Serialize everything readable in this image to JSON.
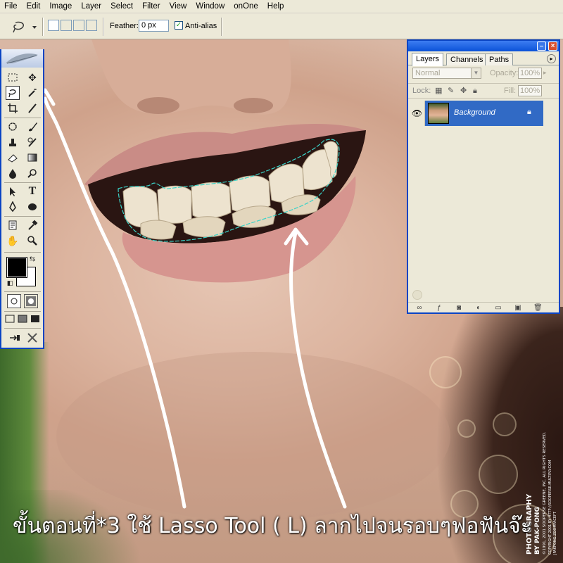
{
  "menubar": {
    "items": [
      "File",
      "Edit",
      "Image",
      "Layer",
      "Select",
      "Filter",
      "View",
      "Window",
      "onOne",
      "Help"
    ]
  },
  "options": {
    "feather_label": "Feather:",
    "feather_value": "0 px",
    "antialias_label": "Anti-alias",
    "antialias_checked": true
  },
  "layers_palette": {
    "tabs": [
      "Layers",
      "Channels",
      "Paths"
    ],
    "active_tab": "Layers",
    "blend_mode": "Normal",
    "opacity_label": "Opacity:",
    "opacity_value": "100%",
    "lock_label": "Lock:",
    "fill_label": "Fill:",
    "fill_value": "100%",
    "layers": [
      {
        "name": "Background",
        "visible": true,
        "locked": true,
        "selected": true
      }
    ]
  },
  "tools": {
    "active": "lasso-tool"
  },
  "overlay": {
    "caption": "ขั้นตอนที่*3 ใช้ Lasso Tool ( L) ลากไปจนรอบๆฟอฟันจ๊ะ",
    "credit_lines": [
      "PHOTOGRAPHY",
      "BY PAK-PONG",
      "©1991, 2001 SOOPERSE GREENE, INC. ALL RIGHTS RESERVED.",
      "COPYRIGHT 2001 BY HTTP://SOOPERSE.MULTIPLY.COM",
      "JPAKPONG ZOOMFACEFT"
    ]
  },
  "colors": {
    "xp_blue": "#0a44c4",
    "panel": "#ece9d8",
    "selection": "#316ac5",
    "selection_path": "#3ad3c8"
  }
}
